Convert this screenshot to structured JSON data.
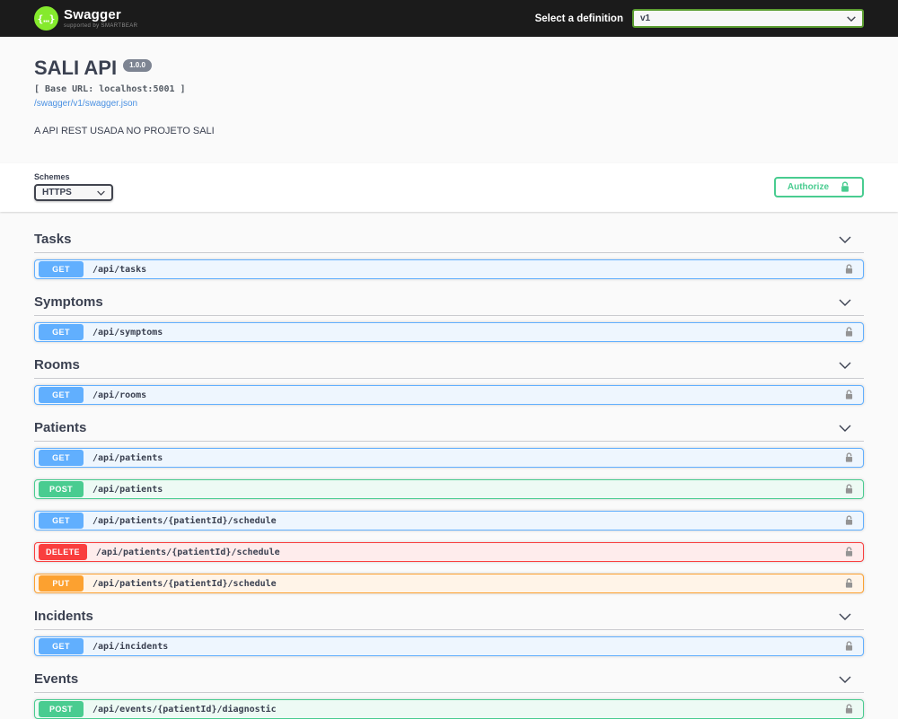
{
  "topbar": {
    "logo_title": "Swagger",
    "logo_subtitle": "supported by SMARTBEAR",
    "definition_label": "Select a definition",
    "selected_definition": "v1"
  },
  "info": {
    "title": "SALI API",
    "version_badge": "1.0.0",
    "base_url_text": "[ Base URL: localhost:5001 ]",
    "spec_link": "/swagger/v1/swagger.json",
    "description": "A API REST USADA NO PROJETO SALI"
  },
  "scheme": {
    "label": "Schemes",
    "selected_scheme": "HTTPS",
    "authorize_label": "Authorize"
  },
  "colors": {
    "topbar_bg": "#1b1b1b",
    "logo_green": "#85ea2d",
    "definition_select_border": "#5c9e31",
    "get": "#61affe",
    "post": "#49cc90",
    "delete": "#f93e3e",
    "put": "#fca130",
    "authorize_green": "#49cc90",
    "link_blue": "#4990e2",
    "lock_gray": "#949494",
    "heading_text": "#3b4151"
  },
  "sections": [
    {
      "name": "Tasks",
      "endpoints": [
        {
          "method": "GET",
          "path": "/api/tasks"
        }
      ]
    },
    {
      "name": "Symptoms",
      "endpoints": [
        {
          "method": "GET",
          "path": "/api/symptoms"
        }
      ]
    },
    {
      "name": "Rooms",
      "endpoints": [
        {
          "method": "GET",
          "path": "/api/rooms"
        }
      ]
    },
    {
      "name": "Patients",
      "endpoints": [
        {
          "method": "GET",
          "path": "/api/patients"
        },
        {
          "method": "POST",
          "path": "/api/patients"
        },
        {
          "method": "GET",
          "path": "/api/patients/{patientId}/schedule"
        },
        {
          "method": "DELETE",
          "path": "/api/patients/{patientId}/schedule"
        },
        {
          "method": "PUT",
          "path": "/api/patients/{patientId}/schedule"
        }
      ]
    },
    {
      "name": "Incidents",
      "endpoints": [
        {
          "method": "GET",
          "path": "/api/incidents"
        }
      ]
    },
    {
      "name": "Events",
      "endpoints": [
        {
          "method": "POST",
          "path": "/api/events/{patientId}/diagnostic"
        }
      ]
    }
  ]
}
